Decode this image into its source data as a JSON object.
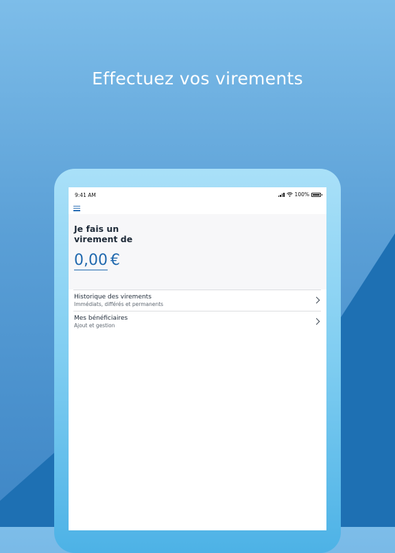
{
  "headline": "Effectuez vos virements",
  "statusbar": {
    "time": "9:41 AM",
    "battery": "100%",
    "battery_level": 1.0,
    "signal_icon": "cellular-signal-icon",
    "wifi_icon": "wifi-icon"
  },
  "nav": {
    "menu_icon": "hamburger-menu-icon"
  },
  "transfer": {
    "prompt": "Je fais un virement de",
    "amount": "0,00",
    "currency": "€"
  },
  "list": [
    {
      "title": "Historique des virements",
      "subtitle": "Immédiats, différés et permanents"
    },
    {
      "title": "Mes bénéficiaires",
      "subtitle": "Ajout et gestion"
    }
  ],
  "colors": {
    "accent": "#1f68ae",
    "background_top": "#7dbde9",
    "background_dark": "#1b6fb3",
    "tablet_frame": "#7fcdf1"
  }
}
